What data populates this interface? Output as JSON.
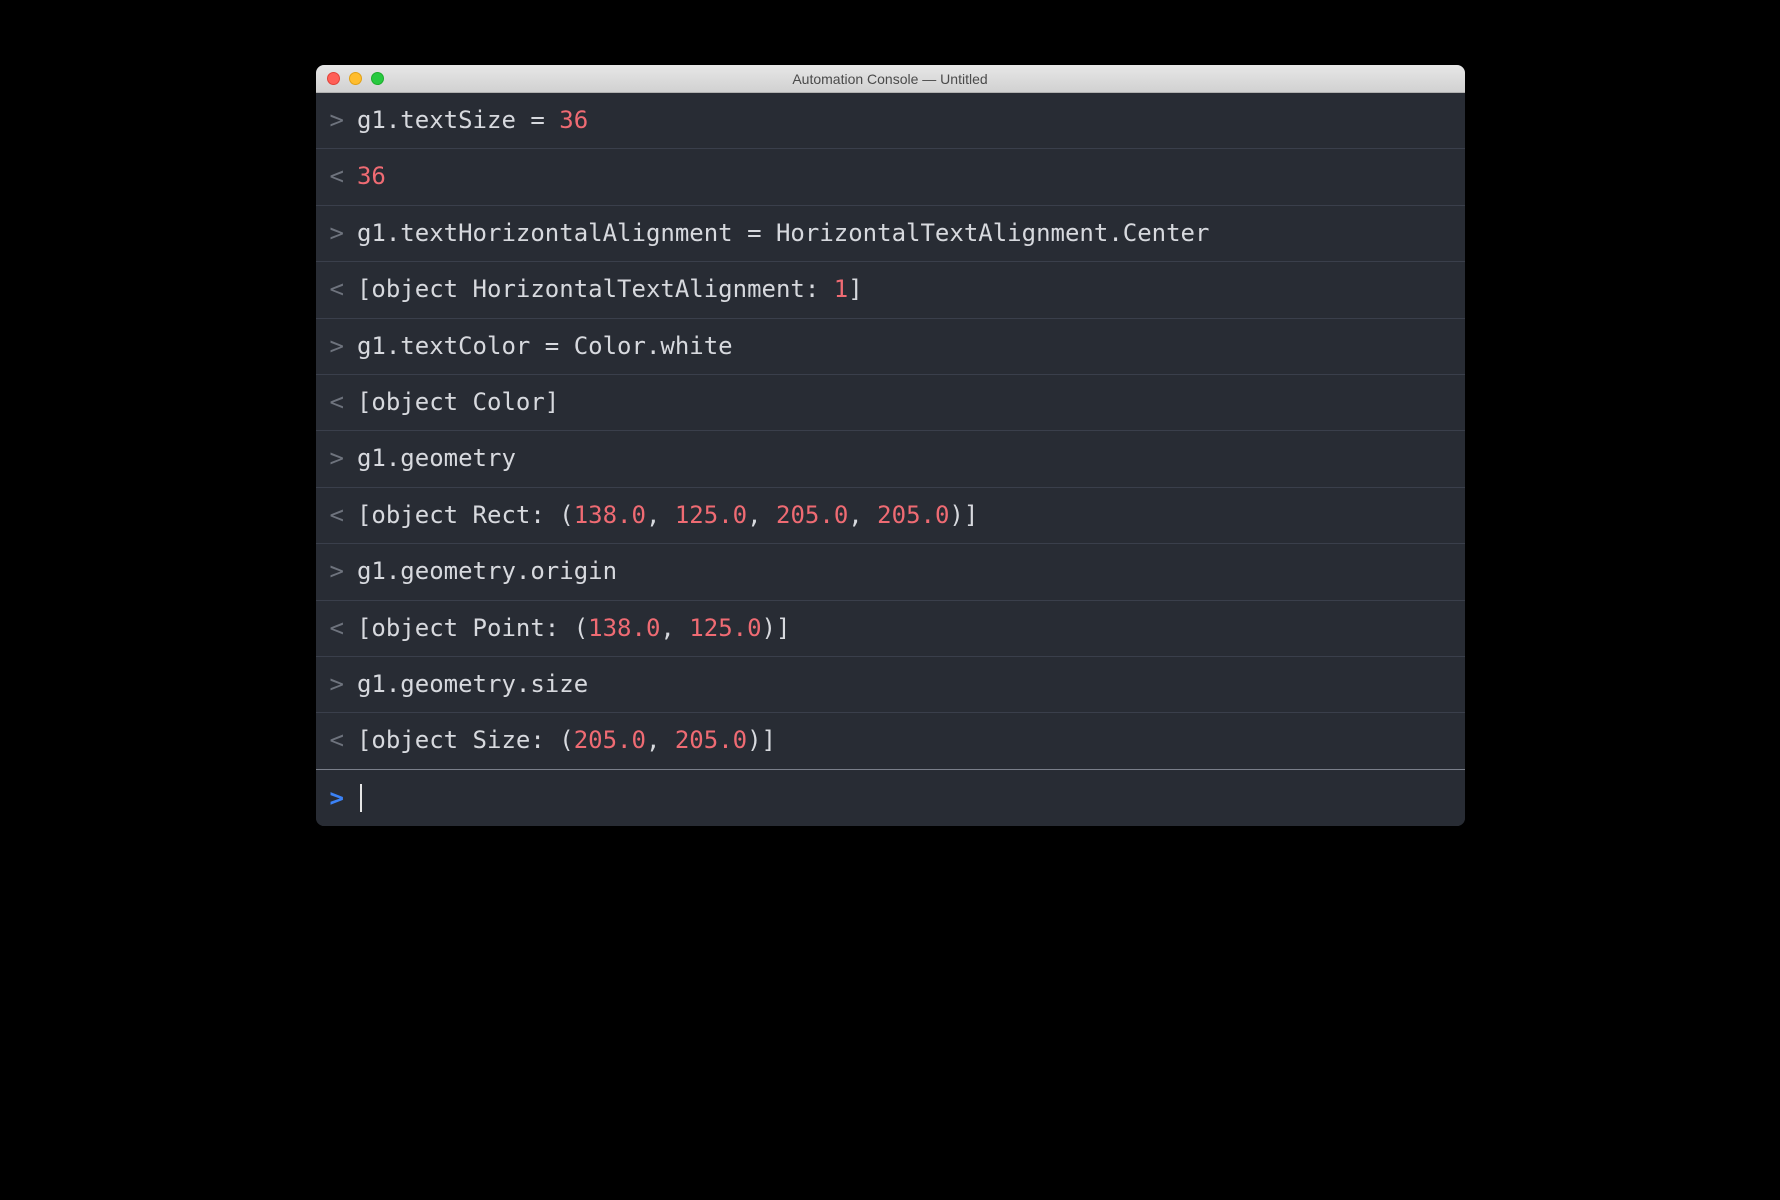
{
  "window": {
    "title": "Automation Console — Untitled"
  },
  "colors": {
    "numberHighlight": "#ef6b73",
    "textColor": "#d7d9de",
    "arrowColor": "#6e737d",
    "activeArrowColor": "#3b82f6",
    "rowBorder": "#3a3f4b"
  },
  "symbols": {
    "in": ">",
    "out": "<",
    "activeIn": ">"
  },
  "rows": [
    {
      "dir": "in",
      "segments": [
        {
          "t": "g1.textSize = ",
          "c": "code"
        },
        {
          "t": "36",
          "c": "num"
        }
      ]
    },
    {
      "dir": "out",
      "segments": [
        {
          "t": "36",
          "c": "num"
        }
      ]
    },
    {
      "dir": "in",
      "segments": [
        {
          "t": "g1.textHorizontalAlignment = HorizontalTextAlignment.Center",
          "c": "code"
        }
      ]
    },
    {
      "dir": "out",
      "segments": [
        {
          "t": "[object HorizontalTextAlignment: ",
          "c": "code"
        },
        {
          "t": "1",
          "c": "num"
        },
        {
          "t": "]",
          "c": "code"
        }
      ]
    },
    {
      "dir": "in",
      "segments": [
        {
          "t": "g1.textColor = Color.white",
          "c": "code"
        }
      ]
    },
    {
      "dir": "out",
      "segments": [
        {
          "t": "[object Color]",
          "c": "code"
        }
      ]
    },
    {
      "dir": "in",
      "segments": [
        {
          "t": "g1.geometry",
          "c": "code"
        }
      ]
    },
    {
      "dir": "out",
      "segments": [
        {
          "t": "[object Rect: (",
          "c": "code"
        },
        {
          "t": "138.0",
          "c": "num"
        },
        {
          "t": ", ",
          "c": "code"
        },
        {
          "t": "125.0",
          "c": "num"
        },
        {
          "t": ", ",
          "c": "code"
        },
        {
          "t": "205.0",
          "c": "num"
        },
        {
          "t": ", ",
          "c": "code"
        },
        {
          "t": "205.0",
          "c": "num"
        },
        {
          "t": ")]",
          "c": "code"
        }
      ]
    },
    {
      "dir": "in",
      "segments": [
        {
          "t": "g1.geometry.origin",
          "c": "code"
        }
      ]
    },
    {
      "dir": "out",
      "segments": [
        {
          "t": "[object Point: (",
          "c": "code"
        },
        {
          "t": "138.0",
          "c": "num"
        },
        {
          "t": ", ",
          "c": "code"
        },
        {
          "t": "125.0",
          "c": "num"
        },
        {
          "t": ")]",
          "c": "code"
        }
      ]
    },
    {
      "dir": "in",
      "segments": [
        {
          "t": "g1.geometry.size",
          "c": "code"
        }
      ]
    },
    {
      "dir": "out",
      "last": true,
      "segments": [
        {
          "t": "[object Size: (",
          "c": "code"
        },
        {
          "t": "205.0",
          "c": "num"
        },
        {
          "t": ", ",
          "c": "code"
        },
        {
          "t": "205.0",
          "c": "num"
        },
        {
          "t": ")]",
          "c": "code"
        }
      ]
    }
  ]
}
